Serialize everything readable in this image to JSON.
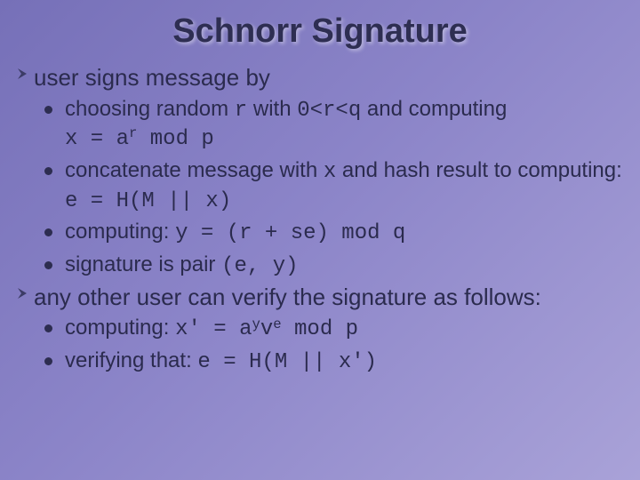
{
  "title": "Schnorr Signature",
  "top1": {
    "lead": "user",
    "rest": " signs message by"
  },
  "s1": {
    "a": "choosing random ",
    "r": "r",
    "b": " with ",
    "cond": "0<r<q",
    "c": " and computing"
  },
  "s1b": {
    "a": "x = a",
    "exp": "r",
    "b": " mod p"
  },
  "s2": {
    "a": "concatenate message with ",
    "x": "x",
    "b": " and hash result to computing: ",
    "eq": "e = H(M || x)"
  },
  "s3": {
    "a": "computing: ",
    "eq": "y = (r + se) mod q"
  },
  "s4": {
    "a": "signature is pair ",
    "eq": "(e, y)"
  },
  "top2": "any other user can verify the signature as follows:",
  "v1": {
    "a": "computing: ",
    "eq1": "x' = a",
    "y": "y",
    "v": "v",
    "e": "e",
    "eq2": " mod p"
  },
  "v2": {
    "a": "verifying that: ",
    "eq": "e = H(M || x')"
  }
}
